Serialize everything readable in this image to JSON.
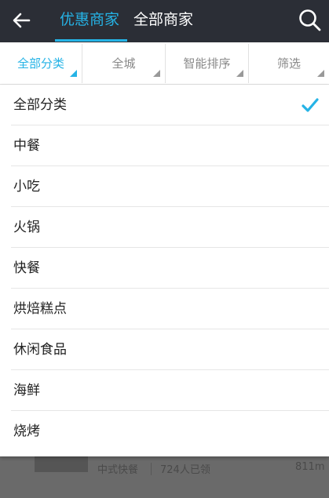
{
  "header": {
    "tabs": [
      {
        "label": "优惠商家",
        "active": true
      },
      {
        "label": "全部商家",
        "active": false
      }
    ],
    "icons": {
      "back": "arrow-left-icon",
      "search": "search-icon"
    },
    "colors": {
      "bar_bg": "#2b2e36",
      "accent": "#25b3e6"
    }
  },
  "filters": [
    {
      "label": "全部分类",
      "active": true
    },
    {
      "label": "全城",
      "active": false
    },
    {
      "label": "智能排序",
      "active": false
    },
    {
      "label": "筛选",
      "active": false
    }
  ],
  "dropdown": {
    "options": [
      {
        "label": "全部分类",
        "selected": true
      },
      {
        "label": "中餐",
        "selected": false
      },
      {
        "label": "小吃",
        "selected": false
      },
      {
        "label": "火锅",
        "selected": false
      },
      {
        "label": "快餐",
        "selected": false
      },
      {
        "label": "烘焙糕点",
        "selected": false
      },
      {
        "label": "休闲食品",
        "selected": false
      },
      {
        "label": "海鲜",
        "selected": false
      },
      {
        "label": "烧烤",
        "selected": false
      }
    ],
    "check_icon": "checkmark-icon"
  },
  "background_listing": {
    "category": "中式快餐",
    "claimed": "724人已领",
    "distance": "811m"
  }
}
